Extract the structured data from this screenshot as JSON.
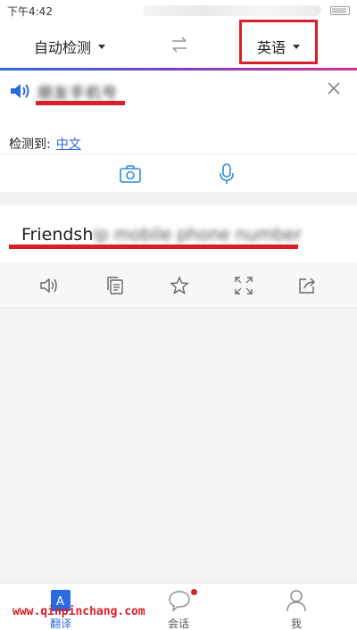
{
  "status_bar": {
    "time": "下午4:42"
  },
  "lang_bar": {
    "source_language": "自动检测",
    "target_language": "英语",
    "swap_icon": "swap-arrows-icon"
  },
  "source_panel": {
    "text": "朋友手机号",
    "detected_label": "检测到:",
    "detected_value": "中文",
    "speaker_icon": "speaker-icon",
    "close_icon": "close-icon"
  },
  "input_tools": {
    "camera_icon": "camera-icon",
    "mic_icon": "microphone-icon"
  },
  "result_panel": {
    "text_visible": "Friendsh",
    "text_blurred": "ip mobile phone number"
  },
  "result_actions": [
    "speaker-icon",
    "copy-icon",
    "star-icon",
    "fullscreen-icon",
    "share-icon"
  ],
  "tab_bar": {
    "tabs": [
      {
        "label": "翻译",
        "icon": "translate-icon",
        "active": true
      },
      {
        "label": "会话",
        "icon": "chat-bubble-icon",
        "badge": true
      },
      {
        "label": "我",
        "icon": "person-icon"
      }
    ]
  },
  "watermark": "www.qinpinchang.com",
  "colors": {
    "accent": "#2b6be0",
    "highlight": "#d8202a"
  }
}
